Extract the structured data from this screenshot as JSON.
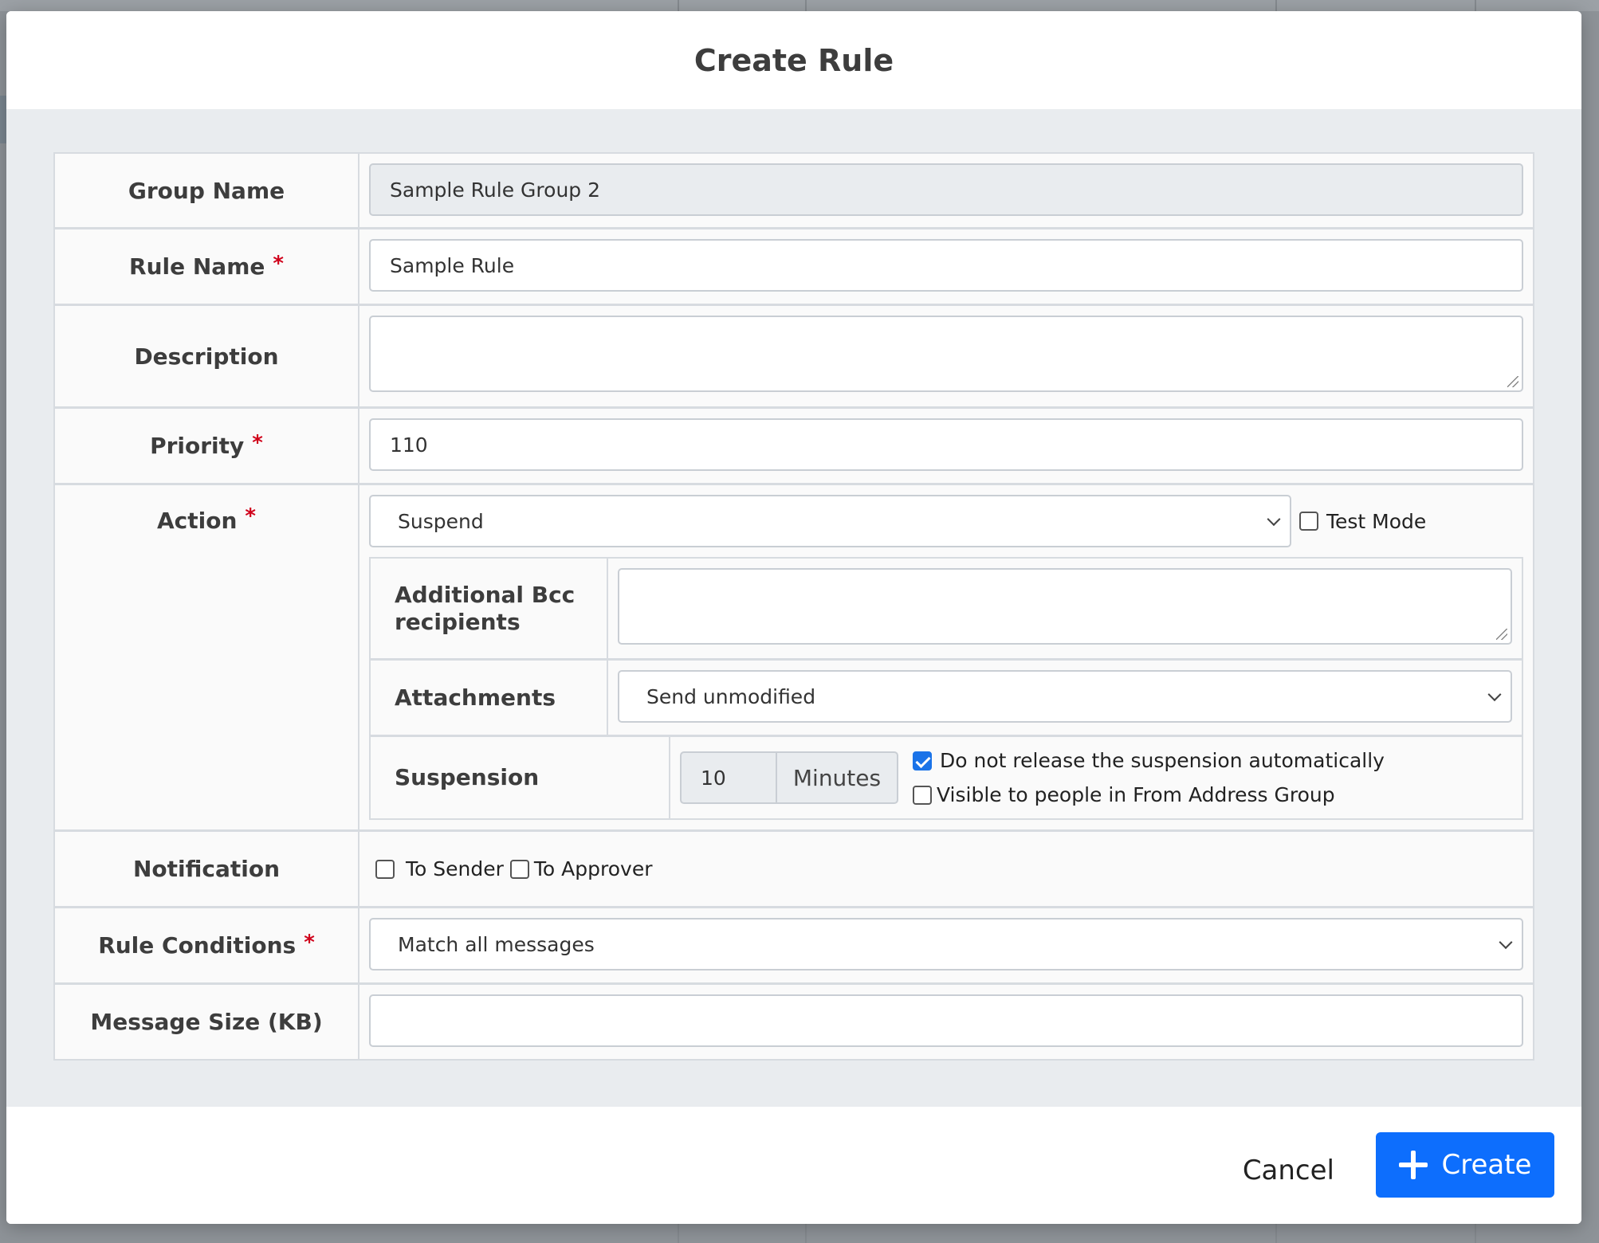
{
  "modal": {
    "title": "Create Rule",
    "cancel_label": "Cancel",
    "create_label": "Create"
  },
  "form": {
    "group_name": {
      "label": "Group Name",
      "value": "Sample Rule Group 2"
    },
    "rule_name": {
      "label": "Rule Name",
      "required": "*",
      "value": "Sample Rule"
    },
    "description": {
      "label": "Description",
      "value": ""
    },
    "priority": {
      "label": "Priority",
      "required": "*",
      "value": "110"
    },
    "action": {
      "label": "Action",
      "required": "*",
      "selected": "Suspend",
      "test_mode_label": "Test Mode",
      "test_mode_checked": false,
      "bcc": {
        "label": "Additional Bcc recipients",
        "value": ""
      },
      "attachments": {
        "label": "Attachments",
        "selected": "Send unmodified"
      },
      "suspension": {
        "label": "Suspension",
        "value": "10",
        "unit": "Minutes",
        "no_auto_release_label": "Do not release the suspension automatically",
        "no_auto_release_checked": true,
        "visible_label": "Visible to people in From Address Group",
        "visible_checked": false
      }
    },
    "notification": {
      "label": "Notification",
      "to_sender_label": "To Sender",
      "to_approver_label": "To Approver"
    },
    "rule_conditions": {
      "label": "Rule Conditions",
      "required": "*",
      "selected": "Match all messages"
    },
    "message_size": {
      "label": "Message Size (KB)",
      "value": ""
    }
  },
  "colors": {
    "primary": "#0d6efd",
    "required": "#d0021b",
    "body_bg": "#e9ecef"
  }
}
